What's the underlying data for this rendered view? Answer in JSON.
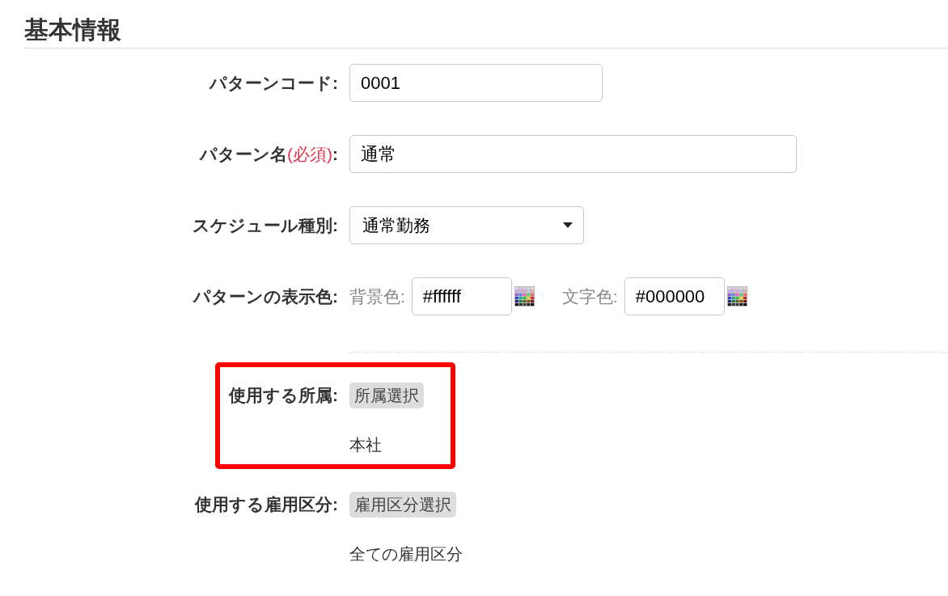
{
  "section": {
    "title": "基本情報"
  },
  "groups": [
    {
      "fields": [
        {
          "kind": "text",
          "label": "パターンコード:",
          "value": "0001"
        },
        {
          "kind": "text",
          "label": "パターン名",
          "required_mark": "(必須)",
          "label_end": ":",
          "value": "通常"
        },
        {
          "kind": "select",
          "label": "スケジュール種別:",
          "value": "通常勤務"
        },
        {
          "kind": "colors",
          "label": "パターンの表示色:",
          "colors": [
            {
              "label": "背景色:",
              "value": "#ffffff"
            },
            {
              "label": "文字色:",
              "value": "#000000"
            }
          ]
        }
      ]
    },
    {
      "fields": [
        {
          "kind": "picker",
          "label": "使用する所属:",
          "button": "所属選択",
          "value": "本社",
          "highlighted": true
        },
        {
          "kind": "picker",
          "label": "使用する雇用区分:",
          "button": "雇用区分選択",
          "value": "全ての雇用区分",
          "highlighted": false
        }
      ]
    }
  ]
}
